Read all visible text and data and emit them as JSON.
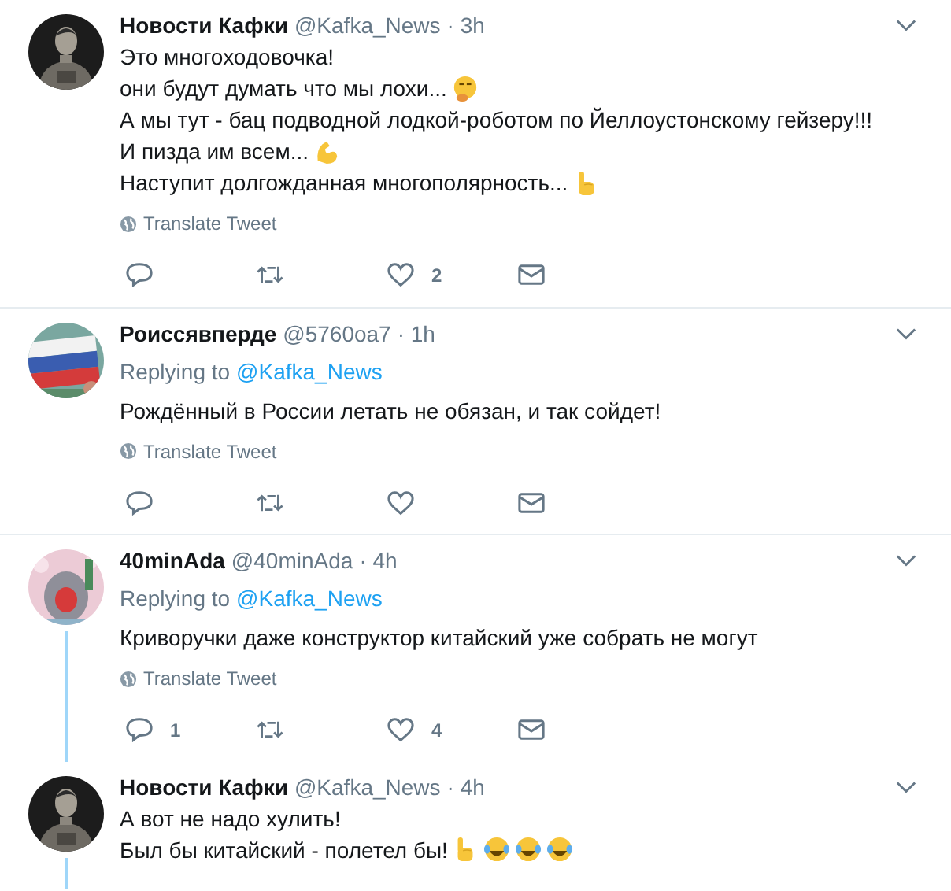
{
  "tweets": [
    {
      "name": "Новости Кафки",
      "handle": "@Kafka_News",
      "time": "· 3h",
      "avatar": {
        "kind": "picture"
      },
      "thread_below": false,
      "lines": [
        {
          "text": "Это многоходовочка!"
        },
        {
          "text": "они будут думать что мы лохи...",
          "emoji": [
            {
              "kind": "thinking"
            }
          ]
        },
        {
          "text": "А мы тут - бац подводной лодкой-роботом по Йеллоустонскому  гейзеру!!!"
        },
        {
          "text": "И пизда им всем...",
          "emoji": [
            {
              "kind": "muscle"
            }
          ]
        },
        {
          "text": "Наступит долгожданная многополярность...",
          "emoji": [
            {
              "kind": "point"
            }
          ]
        }
      ],
      "translate": "Translate Tweet",
      "like_count": "2"
    },
    {
      "name": "Роиссявперде",
      "handle": "@5760oa7",
      "time": "· 1h",
      "avatar": {
        "kind": "picture"
      },
      "thread_below": false,
      "replying": {
        "label": "Replying to",
        "handle": "@Kafka_News"
      },
      "lines": [
        {
          "text": "Рождённый в России летать не обязан, и так сойдет!"
        }
      ],
      "translate": "Translate Tweet"
    },
    {
      "name": "40minAda",
      "handle": "@40minAda",
      "time": "· 4h",
      "avatar": {
        "kind": "picture"
      },
      "thread_below": true,
      "replying": {
        "label": "Replying to",
        "handle": "@Kafka_News"
      },
      "lines": [
        {
          "text": "Криворучки даже конструктор китайский уже собрать не могут"
        }
      ],
      "translate": "Translate Tweet",
      "reply_count": "1",
      "like_count": "4"
    },
    {
      "name": "Новости Кафки",
      "handle": "@Kafka_News",
      "time": "· 4h",
      "avatar": {
        "kind": "picture"
      },
      "thread_below": true,
      "lines": [
        {
          "text": "А вот не надо хулить!"
        },
        {
          "text": "Был бы китайский - полетел бы!",
          "emoji": [
            {
              "kind": "point"
            },
            {
              "kind": "laugh"
            },
            {
              "kind": "laugh"
            },
            {
              "kind": "laugh"
            }
          ]
        }
      ]
    }
  ]
}
